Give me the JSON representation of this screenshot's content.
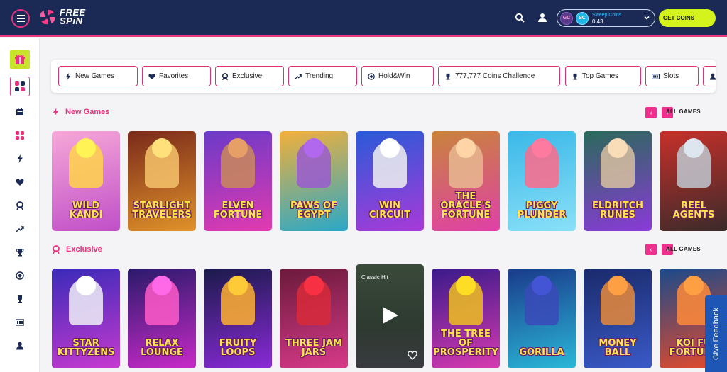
{
  "header": {
    "logo_line1": "FREE",
    "logo_line2": "SPiN",
    "coins_label": "Sweep Coins",
    "coins_value": "0.43",
    "gc_badge": "GC",
    "sc_badge": "SC",
    "get_coins": "GET COINS",
    "icons": [
      "menu-icon",
      "search-icon",
      "user-icon",
      "chevron-down-icon"
    ]
  },
  "sidebar": {
    "items": [
      {
        "icon": "gift-icon"
      },
      {
        "icon": "grid-icon",
        "active": true
      },
      {
        "icon": "calendar-icon"
      },
      {
        "icon": "lobby-icon"
      },
      {
        "icon": "bolt-icon"
      },
      {
        "icon": "heart-icon"
      },
      {
        "icon": "exclusive-icon"
      },
      {
        "icon": "trending-icon"
      },
      {
        "icon": "trophy-icon"
      },
      {
        "icon": "holdwin-icon"
      },
      {
        "icon": "cup-icon"
      },
      {
        "icon": "slots-icon"
      },
      {
        "icon": "profile-icon"
      }
    ]
  },
  "filters": [
    {
      "label": "New Games",
      "icon": "bolt-icon"
    },
    {
      "label": "Favorites",
      "icon": "heart-icon"
    },
    {
      "label": "Exclusive",
      "icon": "exclusive-icon"
    },
    {
      "label": "Trending",
      "icon": "trending-icon"
    },
    {
      "label": "Hold&Win",
      "icon": "holdwin-icon"
    },
    {
      "label": "777,777 Coins Challenge",
      "icon": "trophy-icon"
    },
    {
      "label": "Top Games",
      "icon": "trophy-icon"
    },
    {
      "label": "Slots",
      "icon": "slots-icon"
    }
  ],
  "sections": {
    "new_games": {
      "title": "New Games",
      "all_games": "ALL GAMES",
      "games": [
        {
          "title": "Wild Kandi",
          "bg1": "#f6a8d8",
          "bg2": "#c04fc8",
          "accent": "#ffd34a"
        },
        {
          "title": "Starlight Travelers",
          "bg1": "#7a2a1a",
          "bg2": "#e0922a",
          "accent": "#f5c36b"
        },
        {
          "title": "Elven Fortune",
          "bg1": "#6a3ac8",
          "bg2": "#e23ab0",
          "accent": "#c98a5a"
        },
        {
          "title": "Paws of Egypt",
          "bg1": "#f2b03a",
          "bg2": "#2aa8c8",
          "accent": "#9a5ad0"
        },
        {
          "title": "Win Circuit",
          "bg1": "#2a5ad8",
          "bg2": "#a83ad8",
          "accent": "#f0f0f0"
        },
        {
          "title": "The Oracle's Fortune",
          "bg1": "#c8843a",
          "bg2": "#e040a8",
          "accent": "#e8b890"
        },
        {
          "title": "Piggy Plunder",
          "bg1": "#3ab8e8",
          "bg2": "#8ae0f8",
          "accent": "#ff6a8a"
        },
        {
          "title": "Eldritch Runes",
          "bg1": "#2a6a5a",
          "bg2": "#8a3ad8",
          "accent": "#d8c0a0"
        },
        {
          "title": "Reel Agents",
          "bg1": "#c8302a",
          "bg2": "#3a2a2a",
          "accent": "#c0c8d0"
        }
      ]
    },
    "exclusive": {
      "title": "Exclusive",
      "all_games": "ALL GAMES",
      "games": [
        {
          "title": "Star Kittyzens",
          "bg1": "#3a2ab8",
          "bg2": "#c83ad0",
          "accent": "#f0f0f8"
        },
        {
          "title": "Relax Lounge",
          "bg1": "#2a1a6a",
          "bg2": "#c82ac8",
          "accent": "#ff5ac8"
        },
        {
          "title": "Fruity Loops",
          "bg1": "#1a1a4a",
          "bg2": "#8a2ad8",
          "accent": "#ffb030"
        },
        {
          "title": "Three Jam Jars",
          "bg1": "#6a1a3a",
          "bg2": "#d83a8a",
          "accent": "#d82a3a"
        },
        {
          "title": "Classic Hit",
          "classic": true
        },
        {
          "title": "The Tree of Prosperity",
          "bg1": "#3a1a8a",
          "bg2": "#d83ab0",
          "accent": "#f0c020"
        },
        {
          "title": "Gorilla",
          "bg1": "#1a3a8a",
          "bg2": "#2ab8d8",
          "accent": "#3a4ab8"
        },
        {
          "title": "Money Ball",
          "bg1": "#1a2a6a",
          "bg2": "#3a5ac8",
          "accent": "#e88a3a"
        },
        {
          "title": "Koi Fu Fortune",
          "bg1": "#1a4a8a",
          "bg2": "#e84a2a",
          "accent": "#ff8a3a"
        }
      ]
    }
  },
  "feedback": "Give Feedback",
  "colors": {
    "header_bg": "#1a2a55",
    "accent_pink": "#e8317c",
    "get_coins_bg": "#d4f21c",
    "feedback_bg": "#1e56b6"
  }
}
